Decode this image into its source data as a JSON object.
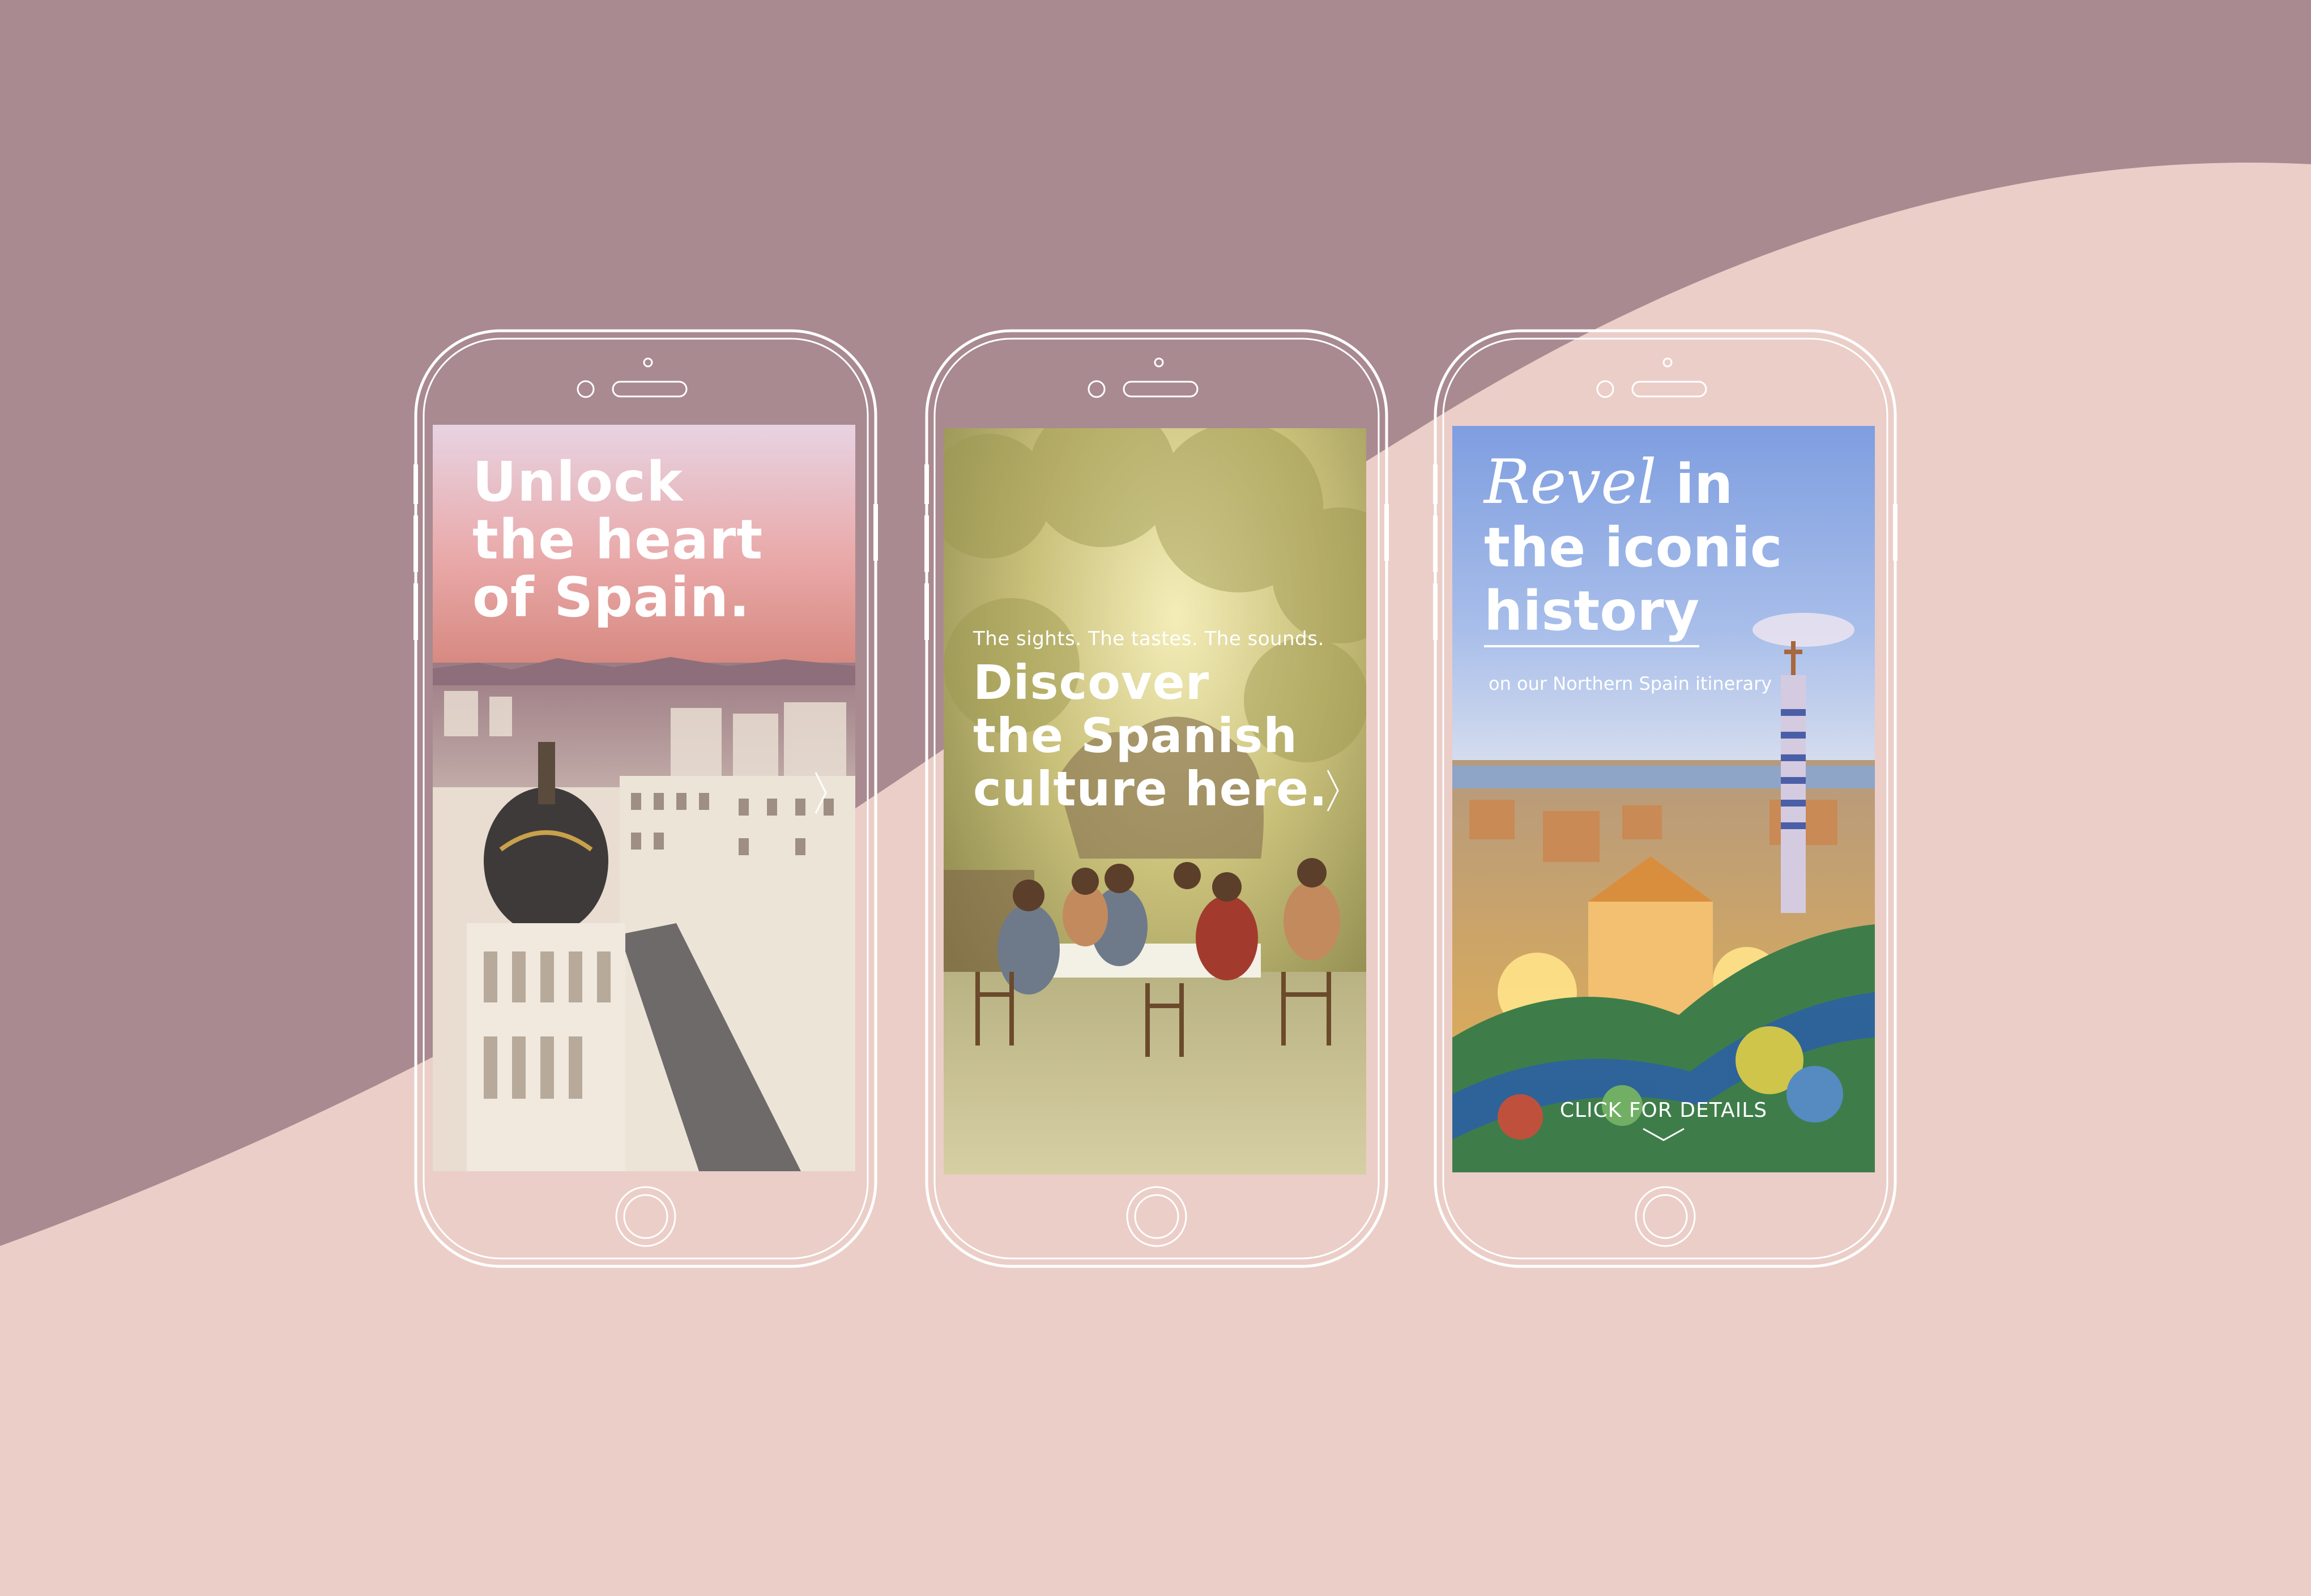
{
  "colors": {
    "background_top": "#A98A90",
    "background_bottom": "#EBCEC8",
    "phone_outline": "#FFFFFF"
  },
  "phones": [
    {
      "headline_lines": [
        "Unlock",
        "the heart",
        "of Spain."
      ],
      "next_icon": "chevron-right-icon",
      "photo": "Madrid city skyline and Gran Via at sunset"
    },
    {
      "kicker": "The sights. The tastes. The sounds.",
      "headline_lines": [
        "Discover",
        "the Spanish",
        "culture here."
      ],
      "next_icon": "chevron-right-icon",
      "photo": "Family dining outdoors under a tree"
    },
    {
      "headline_script": "Revel",
      "headline_lines": [
        "in",
        "the iconic",
        "history"
      ],
      "subline": "on our Northern Spain itinerary",
      "cta": "CLICK FOR DETAILS",
      "cta_icon": "chevron-down-icon",
      "photo": "Park Guell mosaic overlooking Barcelona"
    }
  ]
}
